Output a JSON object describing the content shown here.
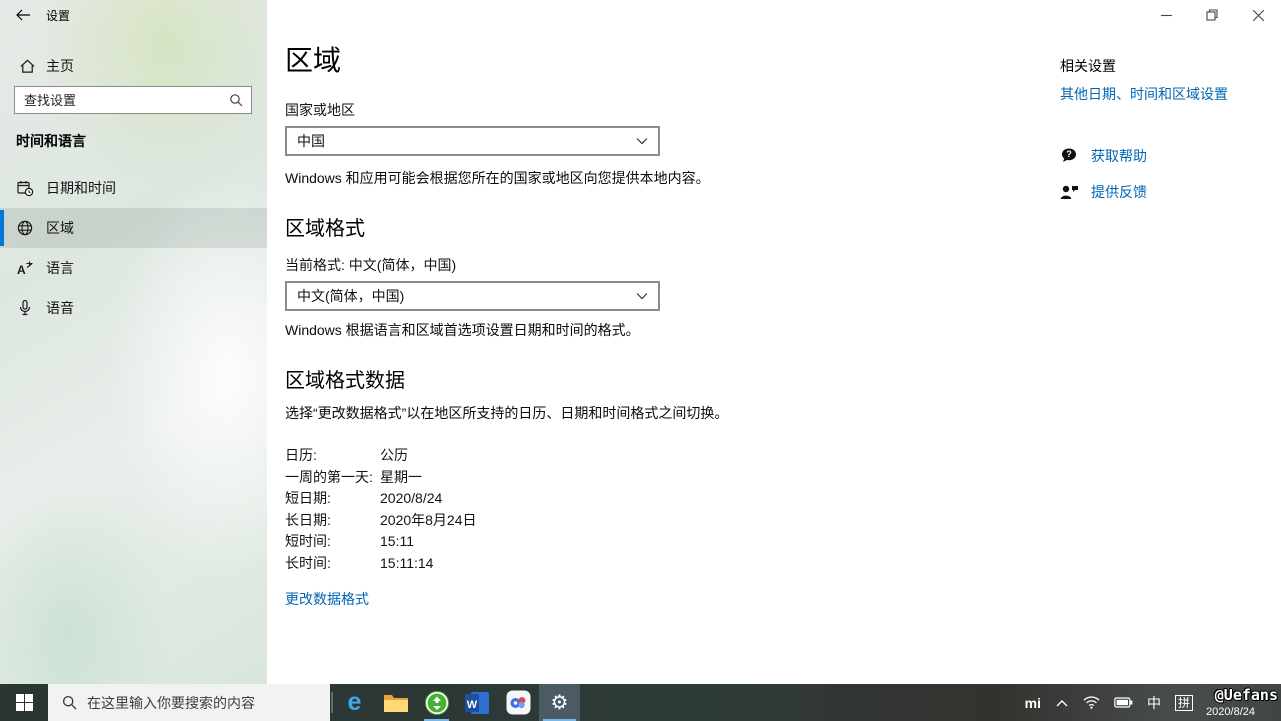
{
  "window": {
    "title": "设置"
  },
  "sidebar": {
    "home": "主页",
    "search_placeholder": "查找设置",
    "section": "时间和语言",
    "items": [
      {
        "label": "日期和时间"
      },
      {
        "label": "区域"
      },
      {
        "label": "语言"
      },
      {
        "label": "语音"
      }
    ]
  },
  "main": {
    "title": "区域",
    "country": {
      "label": "国家或地区",
      "value": "中国",
      "description": "Windows 和应用可能会根据您所在的国家或地区向您提供本地内容。"
    },
    "format": {
      "heading": "区域格式",
      "current": "当前格式: 中文(简体，中国)",
      "value": "中文(简体，中国)",
      "description": "Windows 根据语言和区域首选项设置日期和时间的格式。"
    },
    "data": {
      "heading": "区域格式数据",
      "description": "选择“更改数据格式”以在地区所支持的日历、日期和时间格式之间切换。",
      "rows": [
        {
          "label": "日历:",
          "value": "公历"
        },
        {
          "label": "一周的第一天:",
          "value": "星期一"
        },
        {
          "label": "短日期:",
          "value": "2020/8/24"
        },
        {
          "label": "长日期:",
          "value": "2020年8月24日"
        },
        {
          "label": "短时间:",
          "value": "15:11"
        },
        {
          "label": "长时间:",
          "value": "15:11:14"
        }
      ],
      "change_link": "更改数据格式"
    }
  },
  "related": {
    "heading": "相关设置",
    "settings_link": "其他日期、时间和区域设置",
    "help_link": "获取帮助",
    "feedback_link": "提供反馈"
  },
  "taskbar": {
    "search_placeholder": "在这里输入你要搜索的内容",
    "tray": {
      "mi": "mi",
      "lang_mode": "中",
      "ime": "拼",
      "date": "2020/8/24"
    },
    "watermark": "@Uefans"
  },
  "colors": {
    "accent": "#0078d7",
    "link": "#0066b4"
  }
}
